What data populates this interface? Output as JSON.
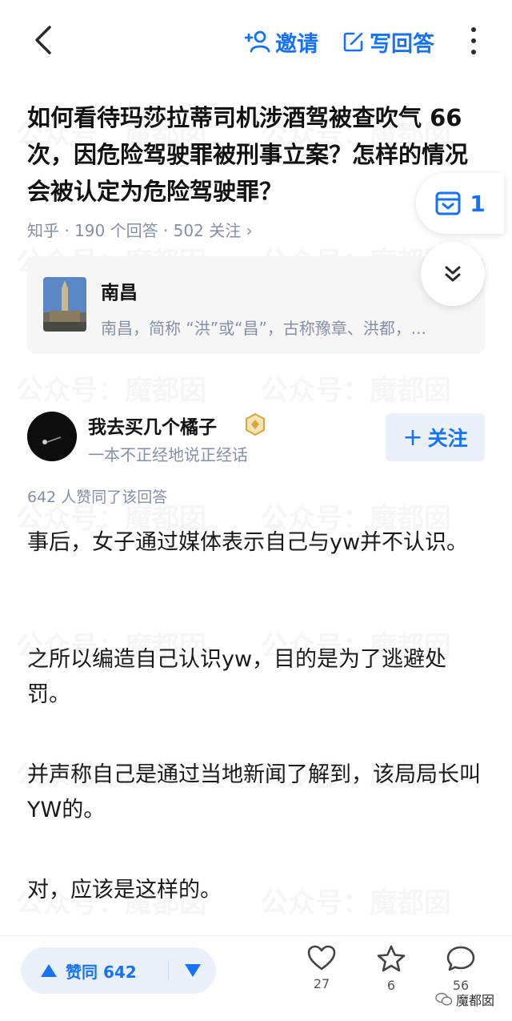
{
  "header": {
    "invite_label": "邀请",
    "write_answer_label": "写回答"
  },
  "question": {
    "title": "如何看待玛莎拉蒂司机涉酒驾被查吹气 66 次，因危险驾驶罪被刑事立案？怎样的情况会被认定为危险驾驶罪？",
    "meta": "知乎 · 190 个回答 · 502 关注 ›",
    "favorite_count": "1"
  },
  "topic": {
    "name": "南昌",
    "description": "南昌，简称 “洪”或“昌”，古称豫章、洪都，..."
  },
  "author": {
    "name": "我去买几个橘子",
    "headline": "一本不正经地说正经话",
    "follow_label": "关注"
  },
  "answer": {
    "vote_text": "642 人赞同了该回答",
    "paragraphs": [
      "事后，女子通过媒体表示自己与yw并不认识。",
      "之所以编造自己认识yw，目的是为了逃避处罚。",
      "并声称自己是通过当地新闻了解到，该局局长叫YW的。",
      "对，应该是这样的。"
    ]
  },
  "bottom_bar": {
    "upvote_label": "赞同 642",
    "like_count": "27",
    "favorite_count": "6",
    "comment_count": "56"
  },
  "watermark": "魔都囡",
  "colors": {
    "accent": "#1772f6",
    "meta_gray": "#8590a6",
    "accent_bg": "#ebf1fb"
  },
  "icons": [
    "back-arrow-icon",
    "add-person-icon",
    "edit-icon",
    "more-vertical-icon",
    "favorites-box-icon",
    "chevron-double-down-icon",
    "verified-badge-icon",
    "triangle-up-icon",
    "triangle-down-icon",
    "heart-icon",
    "star-icon",
    "comment-icon",
    "wechat-icon"
  ]
}
